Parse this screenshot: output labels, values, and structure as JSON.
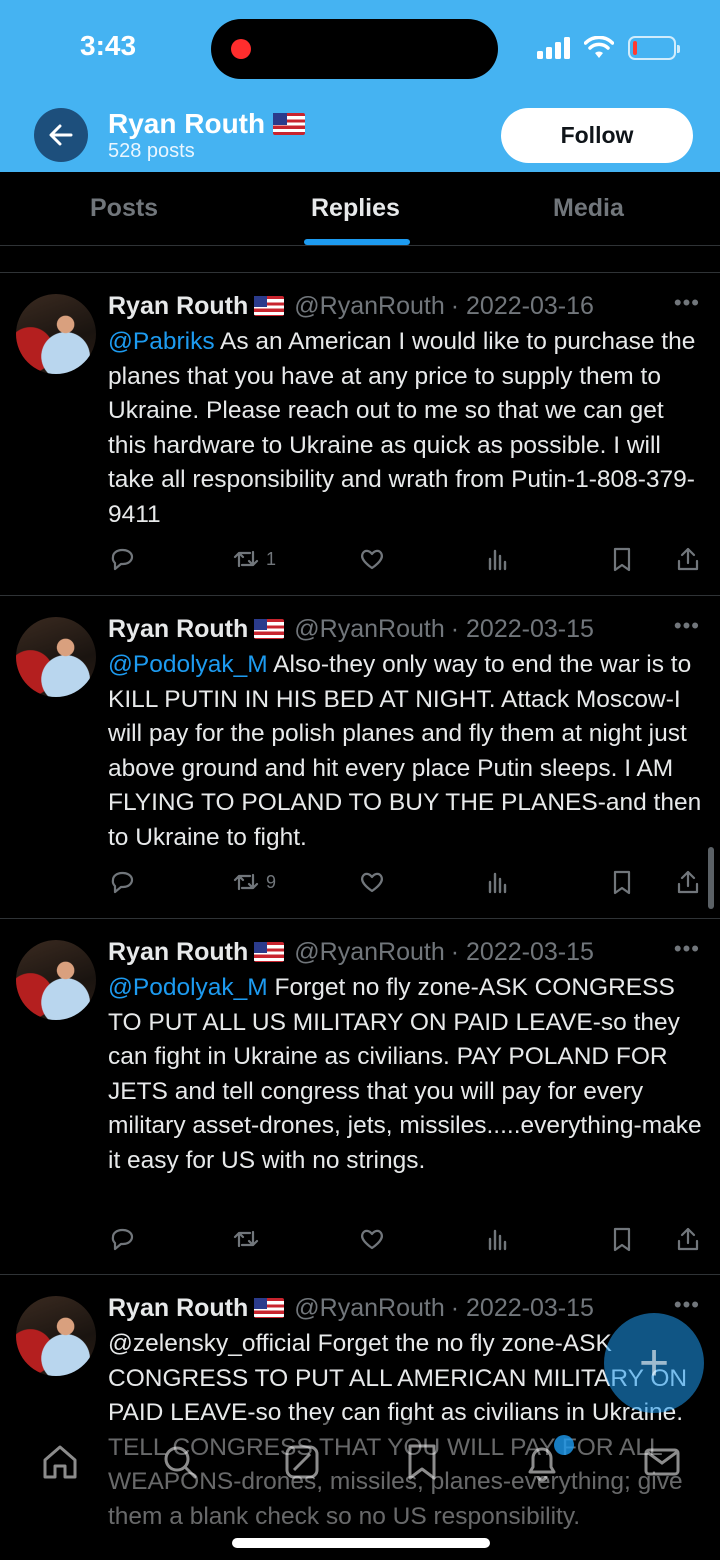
{
  "status_bar": {
    "time": "3:43"
  },
  "header": {
    "profile_name": "Ryan Routh",
    "posts_count": "528 posts",
    "follow_label": "Follow"
  },
  "tabs": [
    {
      "label": "Posts",
      "active": false
    },
    {
      "label": "Replies",
      "active": true
    },
    {
      "label": "Media",
      "active": false
    }
  ],
  "tweets": [
    {
      "name": "Ryan Routh",
      "handle": "@RyanRouth",
      "date": "· 2022-03-16",
      "mention": "@Pabriks",
      "text": " As an American I would like to purchase the planes that you have at any price to supply them to Ukraine.  Please reach out to me so that we can get this hardware to Ukraine as quick as possible. I will take all responsibility and wrath from Putin-1-808-379-9411",
      "retweets": "1"
    },
    {
      "name": "Ryan Routh",
      "handle": "@RyanRouth",
      "date": "· 2022-03-15",
      "mention": "@Podolyak_M",
      "text": " Also-they only way to end the war is to KILL PUTIN IN HIS BED AT NIGHT.  Attack Moscow-I will pay for the polish planes and fly them at night just above ground and hit every place Putin sleeps.  I AM FLYING TO POLAND TO BUY THE PLANES-and then to Ukraine to fight.",
      "retweets": "9"
    },
    {
      "name": "Ryan Routh",
      "handle": "@RyanRouth",
      "date": "· 2022-03-15",
      "mention": "@Podolyak_M",
      "text": " Forget no fly zone-ASK CONGRESS TO PUT ALL US MILITARY ON PAID LEAVE-so they can fight in Ukraine as civilians. PAY POLAND FOR JETS and tell congress that you will pay for every military asset-drones, jets, missiles.....everything-make it easy for US with no strings.",
      "retweets": ""
    },
    {
      "name": "Ryan Routh",
      "handle": "@RyanRouth",
      "date": "· 2022-03-15",
      "mention": "",
      "text": "@zelensky_official Forget the no fly zone-ASK CONGRESS TO PUT ALL AMERICAN MILITARY ON PAID LEAVE-so they can fight as civilians in Ukraine.  TELL CONGRESS THAT YOU WILL PAY FOR ALL WEAPONS-drones, missiles, planes-everything; give them a blank check so no US responsibility.",
      "retweets": ""
    }
  ],
  "icons": {
    "reply": "reply-icon",
    "retweet": "retweet-icon",
    "like": "heart-icon",
    "views": "views-icon",
    "bookmark": "bookmark-icon",
    "share": "share-icon"
  },
  "colors": {
    "header_bg": "#45b3f2",
    "accent": "#1d9bf0",
    "muted": "#71767b"
  }
}
